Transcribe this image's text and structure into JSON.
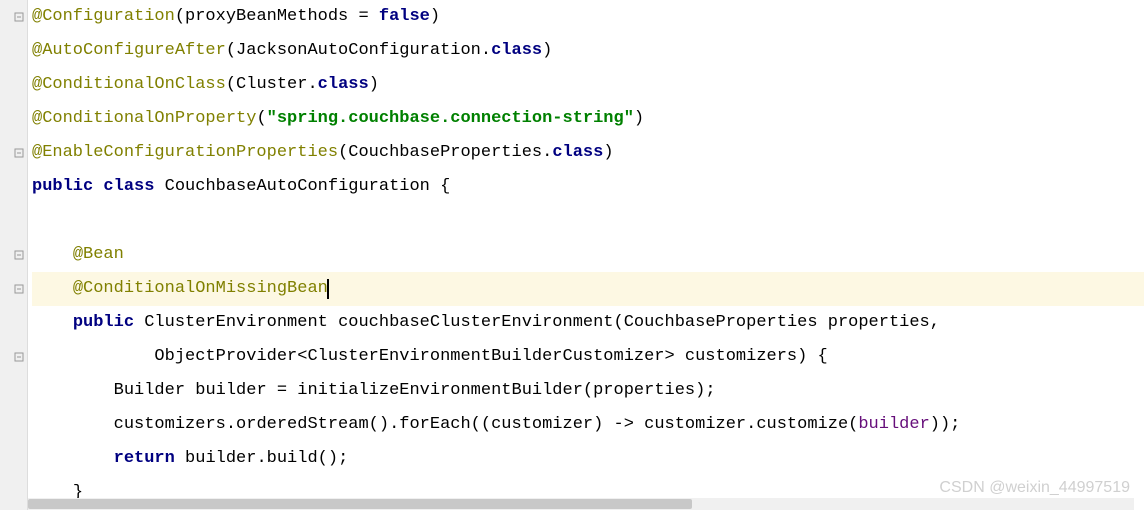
{
  "lines": {
    "l1": {
      "a": "@Configuration",
      "p1": "(",
      "param": "proxyBeanMethods = ",
      "val": "false",
      "p2": ")"
    },
    "l2": {
      "a": "@AutoConfigureAfter",
      "p1": "(JacksonAutoConfiguration.",
      "kw": "class",
      "p2": ")"
    },
    "l3": {
      "a": "@ConditionalOnClass",
      "p1": "(Cluster.",
      "kw": "class",
      "p2": ")"
    },
    "l4": {
      "a": "@ConditionalOnProperty",
      "p1": "(",
      "str": "\"spring.couchbase.connection-string\"",
      "p2": ")"
    },
    "l5": {
      "a": "@EnableConfigurationProperties",
      "p1": "(CouchbaseProperties.",
      "kw": "class",
      "p2": ")"
    },
    "l6": {
      "kw1": "public",
      "kw2": "class",
      "name": " CouchbaseAutoConfiguration {"
    },
    "l8": {
      "indent": "    ",
      "a": "@Bean"
    },
    "l9": {
      "indent": "    ",
      "a": "@ConditionalOnMissingBean"
    },
    "l10": {
      "indent": "    ",
      "kw": "public",
      "rest": " ClusterEnvironment couchbaseClusterEnvironment(CouchbaseProperties properties,"
    },
    "l11": {
      "indent": "            ",
      "rest": "ObjectProvider<ClusterEnvironmentBuilderCustomizer> customizers) {"
    },
    "l12": {
      "indent": "        ",
      "rest": "Builder builder = initializeEnvironmentBuilder(properties);"
    },
    "l13": {
      "indent": "        ",
      "part1": "customizers.orderedStream().forEach((customizer) -> customizer.customize(",
      "param": "builder",
      "part2": "));"
    },
    "l14": {
      "indent": "        ",
      "kw": "return",
      "rest": " builder.build();"
    },
    "l15": {
      "indent": "    ",
      "rest": "}"
    }
  },
  "watermark": "CSDN @weixin_44997519"
}
